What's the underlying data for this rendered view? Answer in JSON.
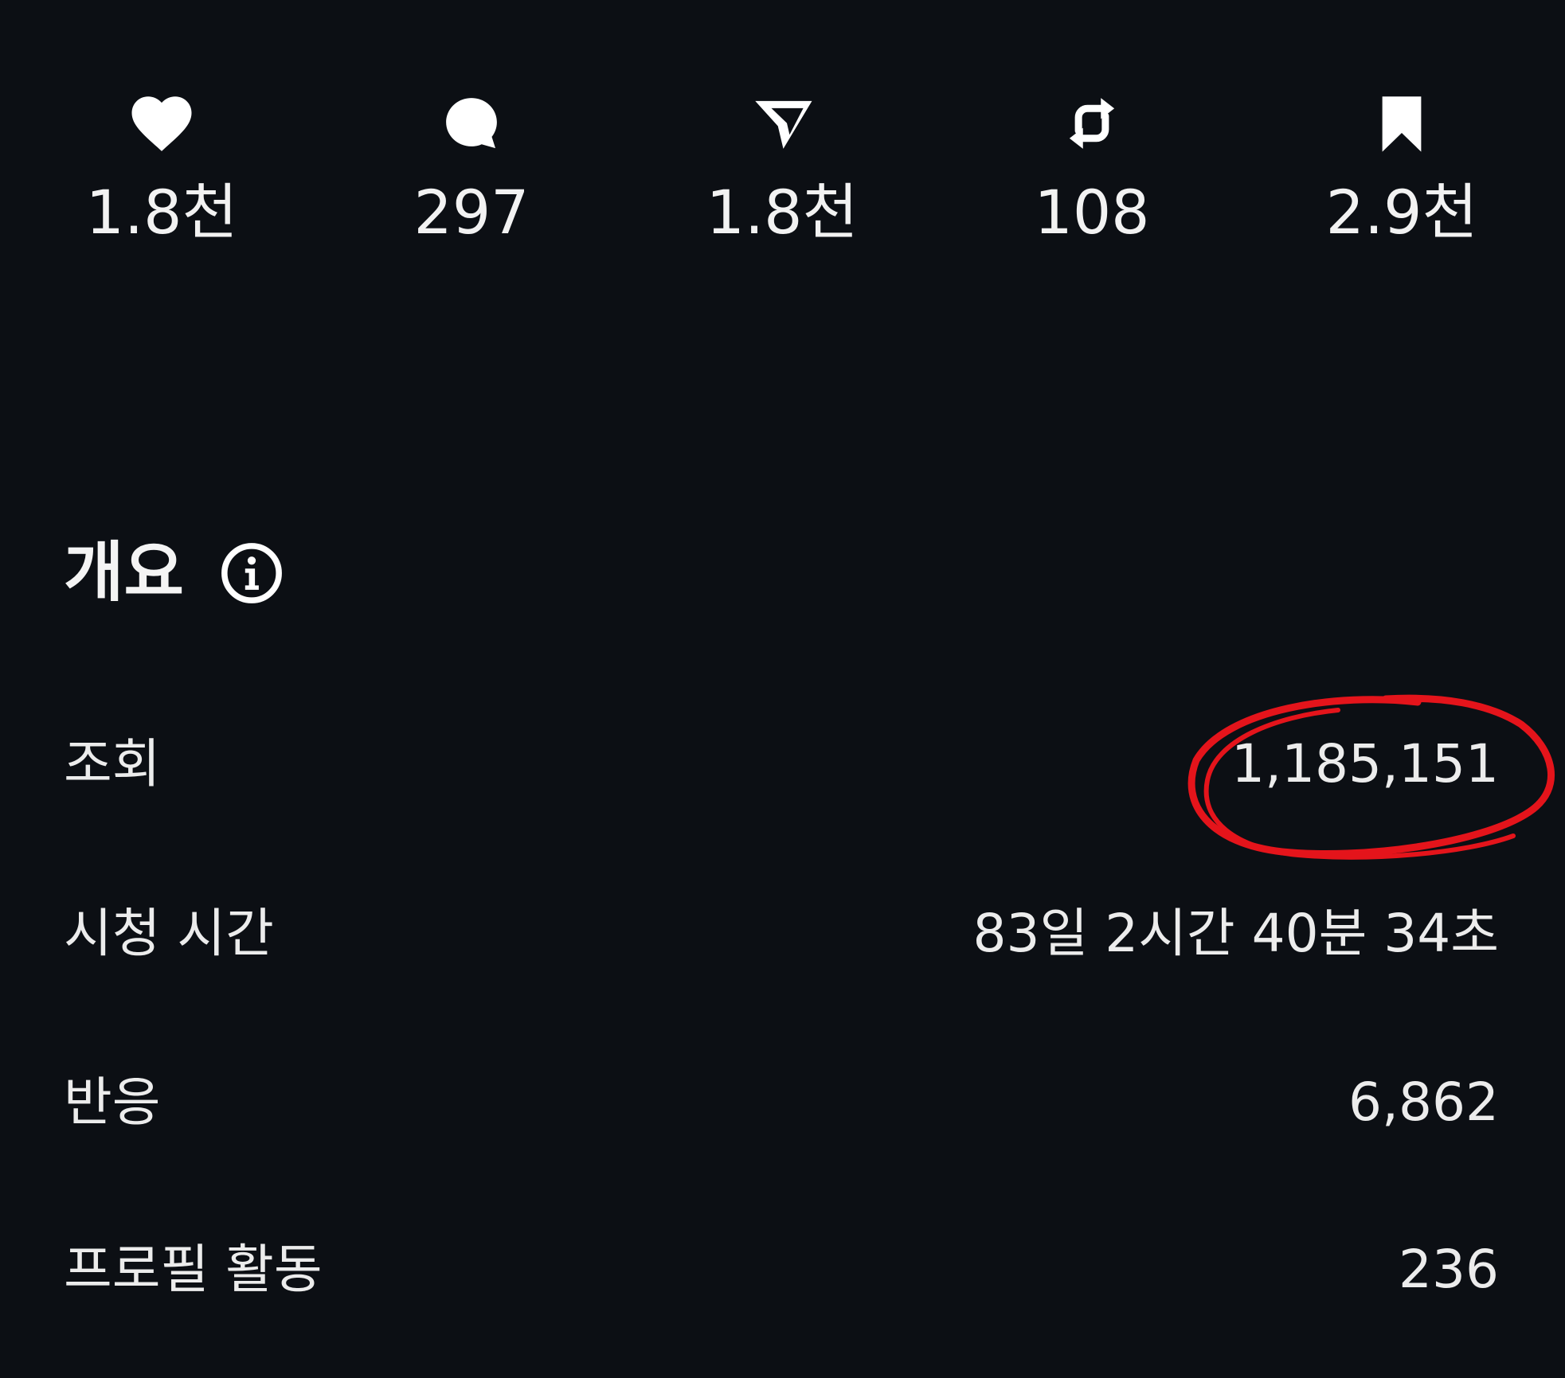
{
  "engagement": [
    {
      "icon": "heart-icon",
      "count": "1.8천"
    },
    {
      "icon": "comment-icon",
      "count": "297"
    },
    {
      "icon": "share-icon",
      "count": "1.8천"
    },
    {
      "icon": "repost-icon",
      "count": "108"
    },
    {
      "icon": "bookmark-icon",
      "count": "2.9천"
    }
  ],
  "overview": {
    "title": "개요",
    "info_icon": "info-icon"
  },
  "metrics": [
    {
      "label": "조회",
      "value": "1,185,151"
    },
    {
      "label": "시청 시간",
      "value": "83일 2시간 40분 34초"
    },
    {
      "label": "반응",
      "value": "6,862"
    },
    {
      "label": "프로필 활동",
      "value": "236"
    }
  ],
  "colors": {
    "background": "#0c0f14",
    "text": "#f2f2f2",
    "highlight_circle": "#e4141b"
  }
}
